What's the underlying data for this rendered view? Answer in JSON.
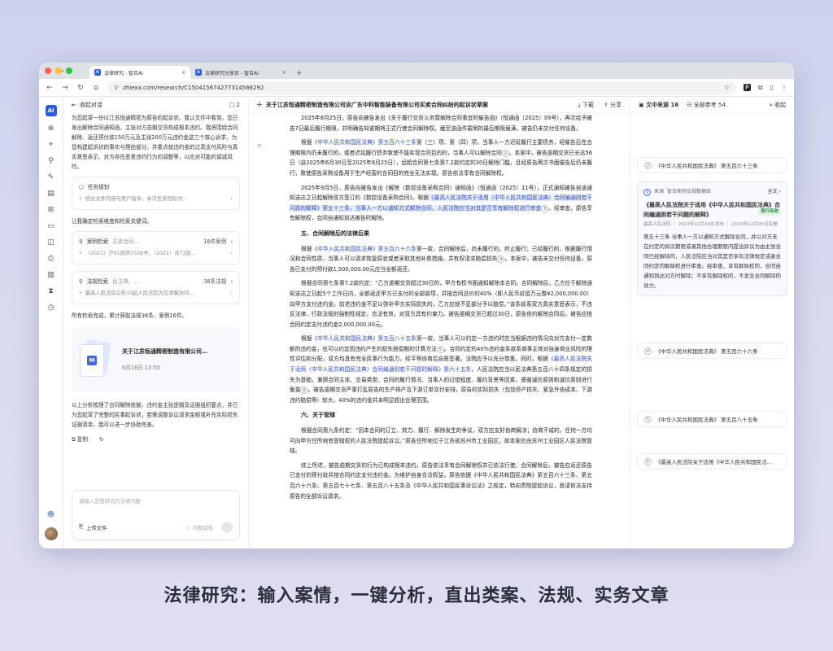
{
  "browser": {
    "tabs": [
      {
        "label": "法律研究 - 智合AI",
        "active": true
      },
      {
        "label": "法律研究分享页 - 智合AI",
        "active": false
      }
    ],
    "url": "zhiexa.com/research/C150415674277314566292"
  },
  "chat": {
    "header": "收起对话",
    "file_count": "2",
    "intro": "为您起草一份以江苏恒通精密为原告的起诉状。我认文件中看到，您已发出解除合同通知函，主张对方逾期交货构成根本违约。我将围绕合同解除、返还预付款150万元及主张200万元违约金这三个核心诉求，为您构建起诉状的事实与理由部分，并重点就违约金的过高支付风险与真实意思表示、对方存在恶意违约行为的调整等，以应对可能的调减风险。",
    "task_card": {
      "title": "任务规划",
      "sub": "结合文件内容与用户指令，本次任务目标为："
    },
    "line2": "让我确定检索维度和检索关键词。",
    "case_card": {
      "type": "案例检索",
      "query": "买卖合同…",
      "count": "16件案例",
      "sub": "（2021）沪01民终2526号、（2021）苏72民…"
    },
    "law_card": {
      "type": "法规检索",
      "query": "民法典、…",
      "count": "38条法规",
      "sub": "最高人民法院公布10起人民法院为京津冀协同…"
    },
    "line3": "所有检索完成，累计获取法规38条、案例16件。",
    "doc_card": {
      "title": "关于江苏恒通精密制造有限公司…",
      "date": "6月16日 13:50"
    },
    "summary": "以上分析梳理了合同解除依据、违约金主张逻辑及证据组织要点，并已为您起草了完整的民事起诉状。若需调整诉讼请求金额或补充实际损失证据清单，我可以进一步协助完善。",
    "copy_label": "复制",
    "input_placeholder": "请输入您想研究的法律问题",
    "upload_label": "上传文件",
    "style_label": "问题润色"
  },
  "document": {
    "title": "关于江苏恒通精密制造有限公司诉广东中科智能装备有限公司买卖合同纠纷的起诉状草案",
    "download": "下载",
    "share": "分享",
    "p0": "2025年8月25日，原告向被告发出《关于履行交货义务暨解除合同事宜的催告函》（恒通函〔2025〕09号），再次给予被告7日最后履行期限，并明确告知逾期将正式行使合同解除权。截至该函件载明的最后期限届满，被告仍未交付任何设备。",
    "p1a": "根据",
    "p1_link": "《中华人民共和国民法典》第五百六十三条",
    "p1b": "第（三）项、第（四）项，当事人一方迟延履行主要债务，经催告后在合理期限内仍未履行的，或者迟延履行债务致使不能实现合同目的的，当事人可以解除合同",
    "p1c": "。本案中，被告逾期交货已长达56日（自2025年6月30日至2025年8月25日），远超合同第七条第7.2款约定的30日解除门槛，且经原告两次书面催告后仍未履行，致使原告采购设备用于生产经营的合同目的完全无法实现。原告依法享有合同解除权。",
    "p2a": "2025年9月5日，原告向被告发出《解除〈数控设备采购合同〉通知函》（恒通函〔2025〕11号），正式通知被告自该通知送达之日起解除双方签订的《数控设备采购合同》。根据",
    "p2_link": "《最高人民法院关于适用〈中华人民共和国民法典〉合同编通则若干问题的解释》第五十三条，当事人一方以通知方式解除合同，人民法院应当对其是否享有解除权进行审查",
    "p2b": "。经审查，原告享有解除权，合同自通知到达被告时解除。",
    "h5": "五、合同解除后的法律后果",
    "p3a": "根据",
    "p3_link": "《中华人民共和国民法典》第五百六十六条",
    "p3b": "第一款，合同解除后，尚未履行的，终止履行；已经履行的，根据履行情况和合同性质，当事人可以请求恢复原状或者采取其他补救措施，并有权请求赔偿损失",
    "p3c": "。本案中，被告未交付任何设备，原告已支付的预付款1,500,000.00元应当全额返还。",
    "p4": "根据合同第七条第7.2款约定：“乙方逾期交货超过30日的，甲方有权书面通知解除本合同，合同解除后，乙方应于解除通知送达之日起5个工作日内，全额返还甲方已支付的全部款项，并按合同总价的40%（即人民币贰佰万元整¥2,000,000.00）向甲方支付违约金。前述违约金不足以弥补甲方实际损失的，乙方应就不足部分予以赔偿。”该条款系双方真实意思表示，不违反法律、行政法规的强制性规定，合法有效。对双方具有约束力。被告逾期交货已超过30日，原告依约解除合同后，被告应按合同约定支付违约金2,000,000.00元。",
    "p5a": "根据",
    "p5_link": "《中华人民共和国民法典》第五百八十五条",
    "p5b": "第一款，当事人可以约定一方违约时应当根据违约情况向对方支付一定数额的违约金，也可以约定因违约产生的损失赔偿额的计算方法",
    "p5c": "。合同约定的40%违约金条款系商事主体对自身商业风险的理性评估和分配，双方均具有完全民事行为能力，经平等协商后自愿签署。法院应予以充分尊重。同时，根据",
    "p5_link2": "《最高人民法院关于适用〈中华人民共和国民法典〉合同编通则若干问题的解释》第六十五条",
    "p5d": "，人民法院应当以民法典第五百八十四条规定的损失为基础，兼顾合同主体、交易类型、合同的履行情况、当事人的过错程度、履约背景等因素，遵循诚信原则和诚信原则进行衡量",
    "p5e": "。被告逾期交货严重打乱原告的生产排产及下游订单交付安排，原告的实际损失（包括停产损失、紧急外协成本、下游违约赔偿等）较大，40%的违约金并未明显超出合理范围。",
    "h6": "六、关于管辖",
    "p6": "根据合同第九条约定：“因本合同的订立、效力、履行、解除发生的争议，双方应友好协商解决；协商不成的，任何一方均可向甲方住所地有管辖权的人民法院提起诉讼。”原告住所地位于江苏省苏州市工业园区，故本案应由苏州工业园区人民法院管辖。",
    "p7": "综上所述，被告逾期交货的行为已构成根本违约，原告依法享有合同解除权并已依法行使。合同解除后，被告应返还原告已支付的预付款并按合同约定支付违约金。为维护自身合法权益，原告依据《中华人民共和国民法典》第五百六十三条、第五百六十六条、第五百七十七条、第五百八十五条及《中华人民共和国民事诉讼法》之规定，特向贵院提起诉讼，恳请依法支持原告的全部诉讼请求。"
  },
  "sources": {
    "tab_text": "文中来源",
    "tab_text_count": "16",
    "tab_all": "全部参考",
    "tab_all_count": "54",
    "collapse": "收起",
    "items": [
      {
        "n": "2",
        "label": "《中华人民共和国民法典》 第五百六十三条"
      },
      {
        "n": "4",
        "label": "《中华人民共和国民法典》 第五百六十六条"
      },
      {
        "n": "5",
        "label": "《中华人民共和国民法典》 第五百八十五条"
      },
      {
        "n": "6",
        "label": "《最高人民法院关于适用《中华人民共和国民法…"
      }
    ],
    "expanded": {
      "n": "3",
      "source": "来源",
      "source_name": "智合案例法规数据库",
      "full": "全文",
      "title": "《最高人民法院关于适用《中华人民共和国民法典》合同编通则若干问题的解释》",
      "badge": "现行有效",
      "meta": "最高人民法院 ｜ 2023年12月04日发布 ｜ 2023年12月05日实施",
      "text": "第五十三条 当事人一方以通知方式解除合同，并以对方未在约定的异议期限或者其他合理期限内提出异议为由主张合同已经解除的，人民法院应当对其是否享有法律规定或者合同约定的解除权进行审查。经审查，享有解除权的，合同自通知到达对方时解除；不享有解除权的，不发生合同解除的效力。"
    }
  },
  "caption": "法律研究：输入案情，一键分析，直出类案、法规、实务文章"
}
